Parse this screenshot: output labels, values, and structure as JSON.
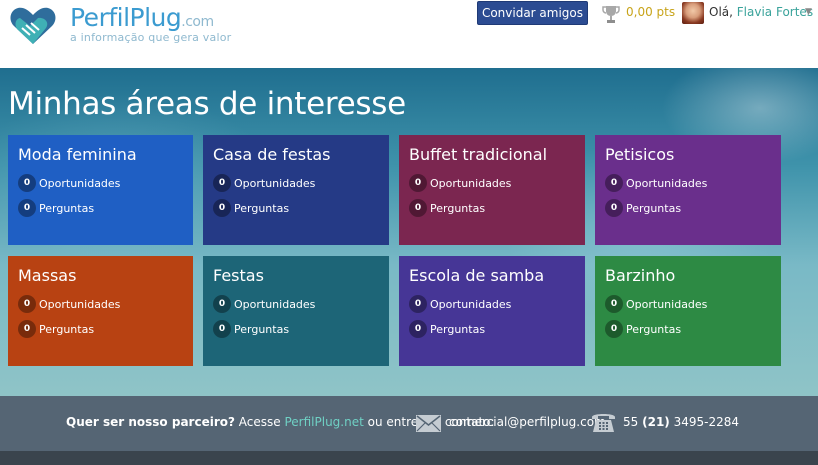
{
  "header": {
    "logo_name": "PerfilPlug",
    "logo_suffix": ".com",
    "tagline": "a informação que gera valor",
    "invite_label": "Convidar amigos",
    "points": "0,00 pts",
    "greeting": "Olá,",
    "user_name": "Flavia Fortes"
  },
  "main": {
    "title": "Minhas áreas de interesse",
    "stat_labels": {
      "opportunities": "Oportunidades",
      "questions": "Perguntas"
    },
    "cards": [
      {
        "title": "Moda feminina",
        "opportunities": "0",
        "questions": "0",
        "color": "#1f5fc4"
      },
      {
        "title": "Casa de festas",
        "opportunities": "0",
        "questions": "0",
        "color": "#253a86"
      },
      {
        "title": "Buffet tradicional",
        "opportunities": "0",
        "questions": "0",
        "color": "#7b2650"
      },
      {
        "title": "Petisicos",
        "opportunities": "0",
        "questions": "0",
        "color": "#6a2f8c"
      },
      {
        "title": "Massas",
        "opportunities": "0",
        "questions": "0",
        "color": "#b84212"
      },
      {
        "title": "Festas",
        "opportunities": "0",
        "questions": "0",
        "color": "#1d6577"
      },
      {
        "title": "Escola de samba",
        "opportunities": "0",
        "questions": "0",
        "color": "#463696"
      },
      {
        "title": "Barzinho",
        "opportunities": "0",
        "questions": "0",
        "color": "#2d8a44"
      }
    ]
  },
  "footer": {
    "question": "Quer ser nosso parceiro?",
    "text_before_link": "Acesse",
    "link": "PerfilPlug.net",
    "text_after_link": "ou entre em contato:",
    "email": "comercial@perfilplug.com",
    "phone_prefix": "55",
    "phone_area": "(21)",
    "phone_number": "3495-2284"
  }
}
